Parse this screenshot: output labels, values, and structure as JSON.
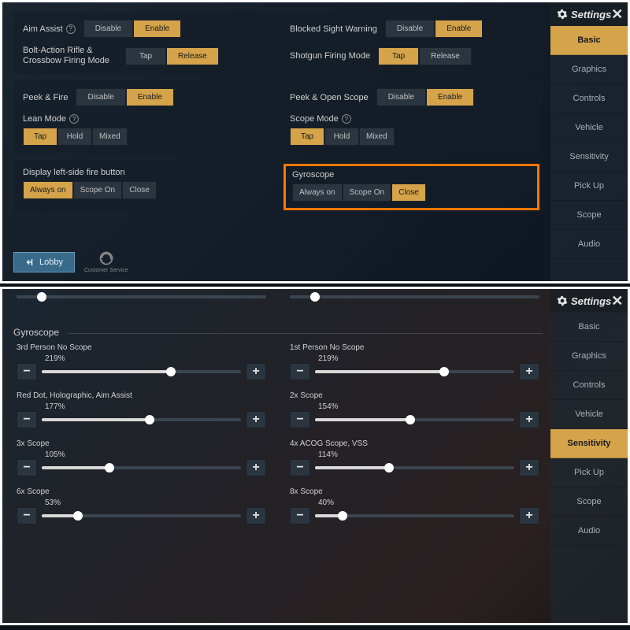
{
  "settings_title": "Settings",
  "nav": {
    "items": [
      "Basic",
      "Graphics",
      "Controls",
      "Vehicle",
      "Sensitivity",
      "Pick Up",
      "Scope",
      "Audio"
    ]
  },
  "topScreen": {
    "activeNav": 0,
    "panel1": {
      "aimAssist": {
        "label": "Aim Assist",
        "options": [
          "Disable",
          "Enable"
        ],
        "active": 1
      },
      "boltAction": {
        "label": "Bolt-Action Rifle & Crossbow Firing Mode",
        "options": [
          "Tap",
          "Release"
        ],
        "active": 1
      },
      "blockedSight": {
        "label": "Blocked Sight Warning",
        "options": [
          "Disable",
          "Enable"
        ],
        "active": 1
      },
      "shotgun": {
        "label": "Shotgun Firing Mode",
        "options": [
          "Tap",
          "Release"
        ],
        "active": 0
      }
    },
    "panel2": {
      "peekFire": {
        "label": "Peek & Fire",
        "options": [
          "Disable",
          "Enable"
        ],
        "active": 1
      },
      "leanMode": {
        "label": "Lean Mode",
        "options": [
          "Tap",
          "Hold",
          "Mixed"
        ],
        "active": 0
      },
      "peekOpenScope": {
        "label": "Peek & Open Scope",
        "options": [
          "Disable",
          "Enable"
        ],
        "active": 1
      },
      "scopeMode": {
        "label": "Scope Mode",
        "options": [
          "Tap",
          "Hold",
          "Mixed"
        ],
        "active": 0
      }
    },
    "panel3": {
      "leftFire": {
        "label": "Display left-side fire button",
        "options": [
          "Always on",
          "Scope On",
          "Close"
        ],
        "active": 0
      },
      "gyroscope": {
        "label": "Gyroscope",
        "options": [
          "Always on",
          "Scope On",
          "Close"
        ],
        "active": 2
      }
    },
    "lobby_label": "Lobby",
    "customer_service": "Customer Service"
  },
  "bottomScreen": {
    "activeNav": 4,
    "sectionTitle": "Gyroscope",
    "sliders": [
      {
        "label": "3rd Person No Scope",
        "value": "219%",
        "pct": 65
      },
      {
        "label": "1st Person No Scope",
        "value": "219%",
        "pct": 65
      },
      {
        "label": "Red Dot, Holographic, Aim Assist",
        "value": "177%",
        "pct": 54
      },
      {
        "label": "2x Scope",
        "value": "154%",
        "pct": 48
      },
      {
        "label": "3x Scope",
        "value": "105%",
        "pct": 34
      },
      {
        "label": "4x ACOG Scope, VSS",
        "value": "114%",
        "pct": 37
      },
      {
        "label": "6x Scope",
        "value": "53%",
        "pct": 18
      },
      {
        "label": "8x Scope",
        "value": "40%",
        "pct": 14
      }
    ]
  }
}
